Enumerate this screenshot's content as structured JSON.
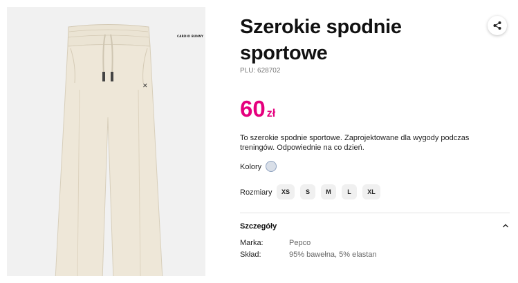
{
  "product": {
    "title": "Szerokie spodnie sportowe",
    "plu": "PLU: 628702",
    "price_amount": "60",
    "price_currency": "zł",
    "description": "To szerokie spodnie sportowe. Zaprojektowane dla wygody podczas treningów. Odpowiednie na co dzień.",
    "brand_logo_text": "CARDIO BUNNY"
  },
  "colors": {
    "label": "Kolory",
    "selected_swatch": "#d9dfe8"
  },
  "sizes": {
    "label": "Rozmiary",
    "options": [
      "XS",
      "S",
      "M",
      "L",
      "XL"
    ]
  },
  "details": {
    "title": "Szczegóły",
    "rows": [
      {
        "label": "Marka:",
        "value": "Pepco"
      },
      {
        "label": "Skład:",
        "value": "95% bawełna, 5% elastan"
      }
    ]
  },
  "icons": {
    "share": "share-icon",
    "collapse": "chevron-up-icon"
  },
  "theme": {
    "accent": "#e5007e",
    "gallery_bg": "#f1f1f1",
    "pants_color": "#ece5d6"
  }
}
